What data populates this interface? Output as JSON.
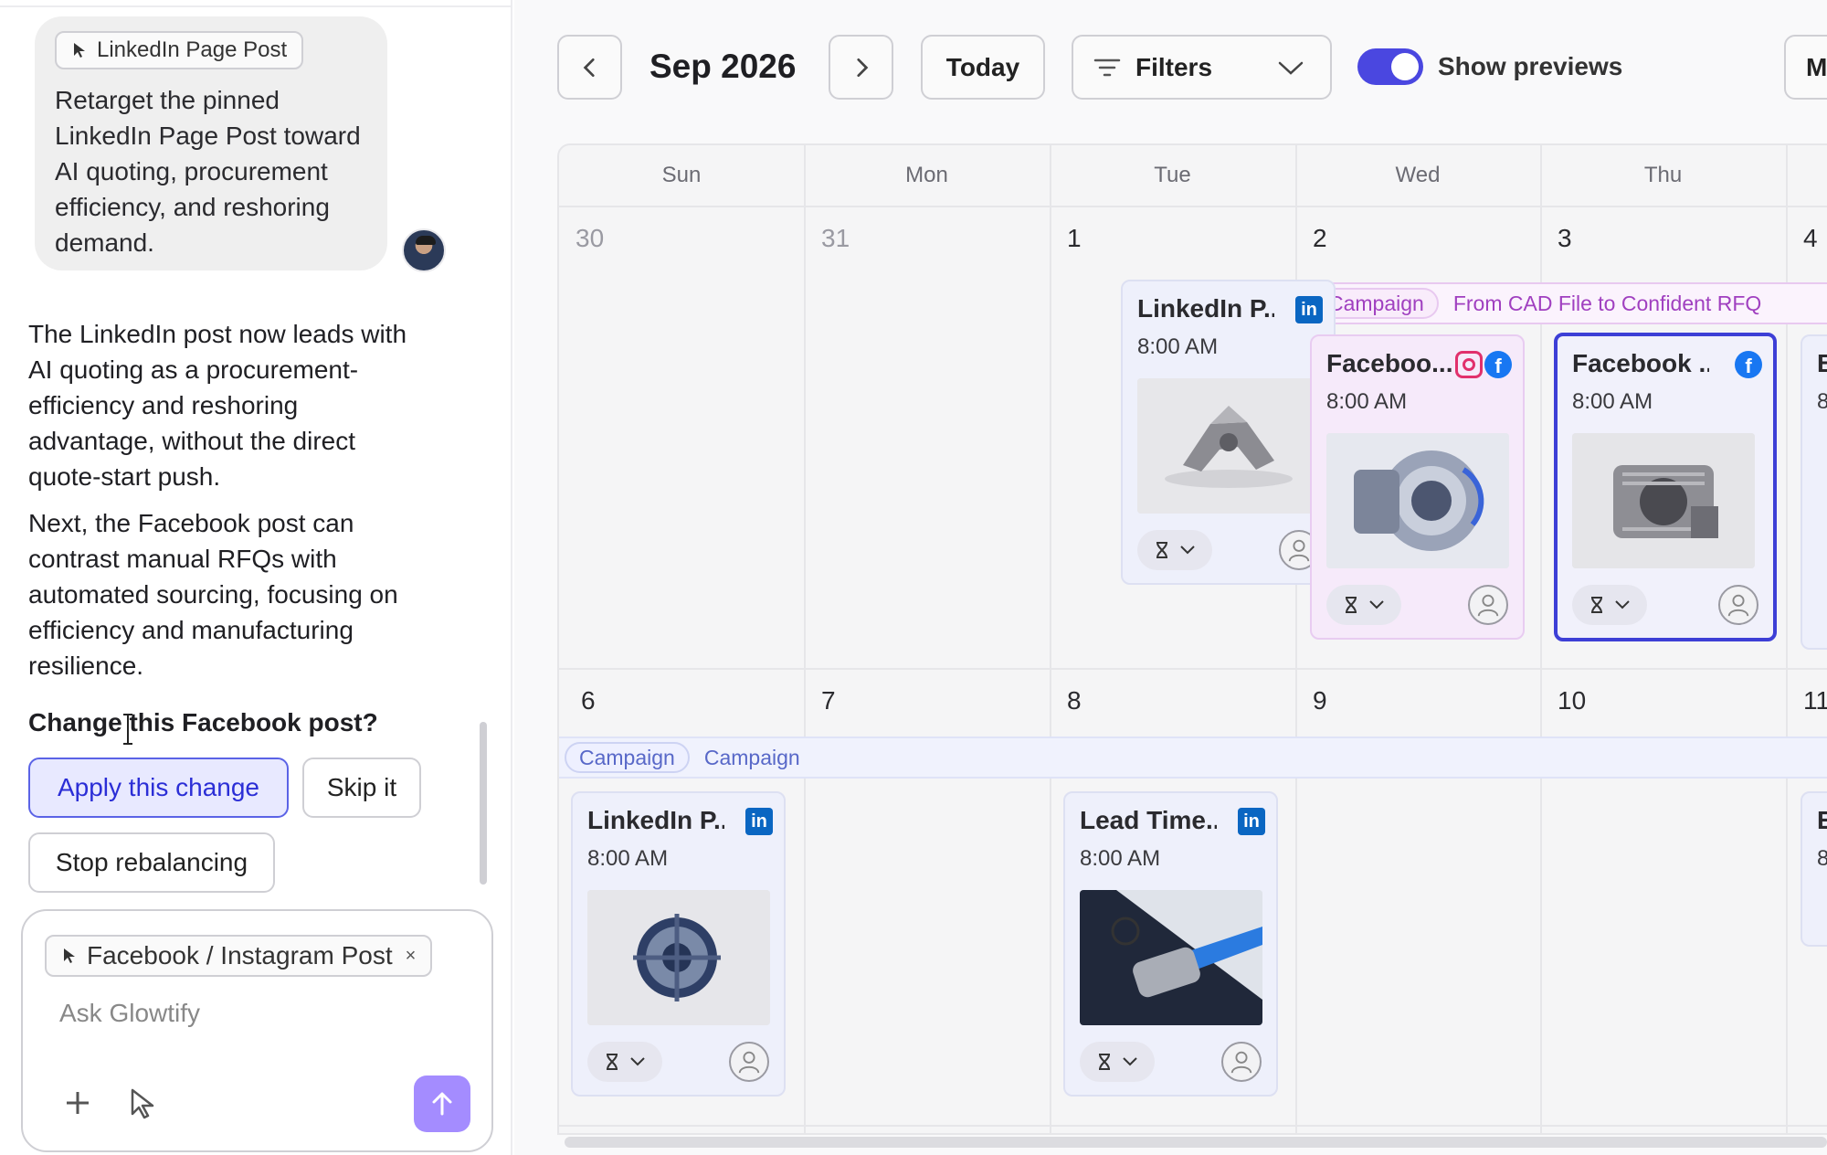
{
  "chat": {
    "user_message": {
      "context_chip": "LinkedIn Page Post",
      "text": "Retarget the pinned LinkedIn Page Post toward AI quoting, procurement efficiency, and reshoring demand."
    },
    "assistant_paragraphs": [
      "The LinkedIn post now leads with AI quoting as a procurement-efficiency and reshoring advantage, without the direct quote-start push.",
      "Next, the Facebook post can contrast manual RFQs with automated sourcing, focusing on efficiency and manufacturing resilience."
    ],
    "question": "Change this Facebook post?",
    "actions": {
      "apply": "Apply this change",
      "skip": "Skip it",
      "stop": "Stop rebalancing"
    },
    "composer": {
      "context_chip": "Facebook / Instagram Post",
      "chip_remove": "×",
      "placeholder": "Ask Glowtify"
    }
  },
  "calendar": {
    "month_label": "Sep 2026",
    "today_label": "Today",
    "filters_label": "Filters",
    "show_previews_label": "Show previews",
    "show_previews_on": true,
    "more_button_label": "M",
    "weekdays": [
      "Sun",
      "Mon",
      "Tue",
      "Wed",
      "Thu"
    ],
    "week1_days": [
      "30",
      "31",
      "1",
      "2",
      "3",
      "4"
    ],
    "week2_days": [
      "6",
      "7",
      "8",
      "9",
      "10",
      "11"
    ],
    "week1_campaign": {
      "tag": "Campaign",
      "name": "From CAD File to Confident RFQ"
    },
    "week2_campaigns": {
      "tag": "Campaign",
      "second": "Campaign"
    },
    "posts": {
      "tue1": {
        "title": "LinkedIn P...",
        "time": "8:00 AM",
        "platforms": [
          "linkedin"
        ]
      },
      "wed2": {
        "title": "Faceboo...",
        "time": "8:00 AM",
        "platforms": [
          "instagram",
          "facebook"
        ]
      },
      "thu3": {
        "title": "Facebook ...",
        "time": "8:00 AM",
        "platforms": [
          "facebook"
        ],
        "selected": true
      },
      "fri4_partial": {
        "title": "B",
        "time": "8"
      },
      "sun6": {
        "title": "LinkedIn P...",
        "time": "8:00 AM",
        "platforms": [
          "linkedin"
        ]
      },
      "tue8": {
        "title": "Lead Time...",
        "time": "8:00 AM",
        "platforms": [
          "linkedin"
        ]
      },
      "fri11_partial": {
        "title": "E",
        "time": "8"
      }
    },
    "platform_glyphs": {
      "linkedin": "in",
      "facebook": "f"
    }
  },
  "colors": {
    "accent": "#3d3fd6",
    "apply_bg": "#e8e9ff",
    "send_button": "#a48cff",
    "campaign_purple": "#a040c0",
    "campaign_blue": "#5868c8",
    "linkedin": "#0a66c2",
    "facebook": "#1877f2",
    "instagram": "#e1306c"
  }
}
